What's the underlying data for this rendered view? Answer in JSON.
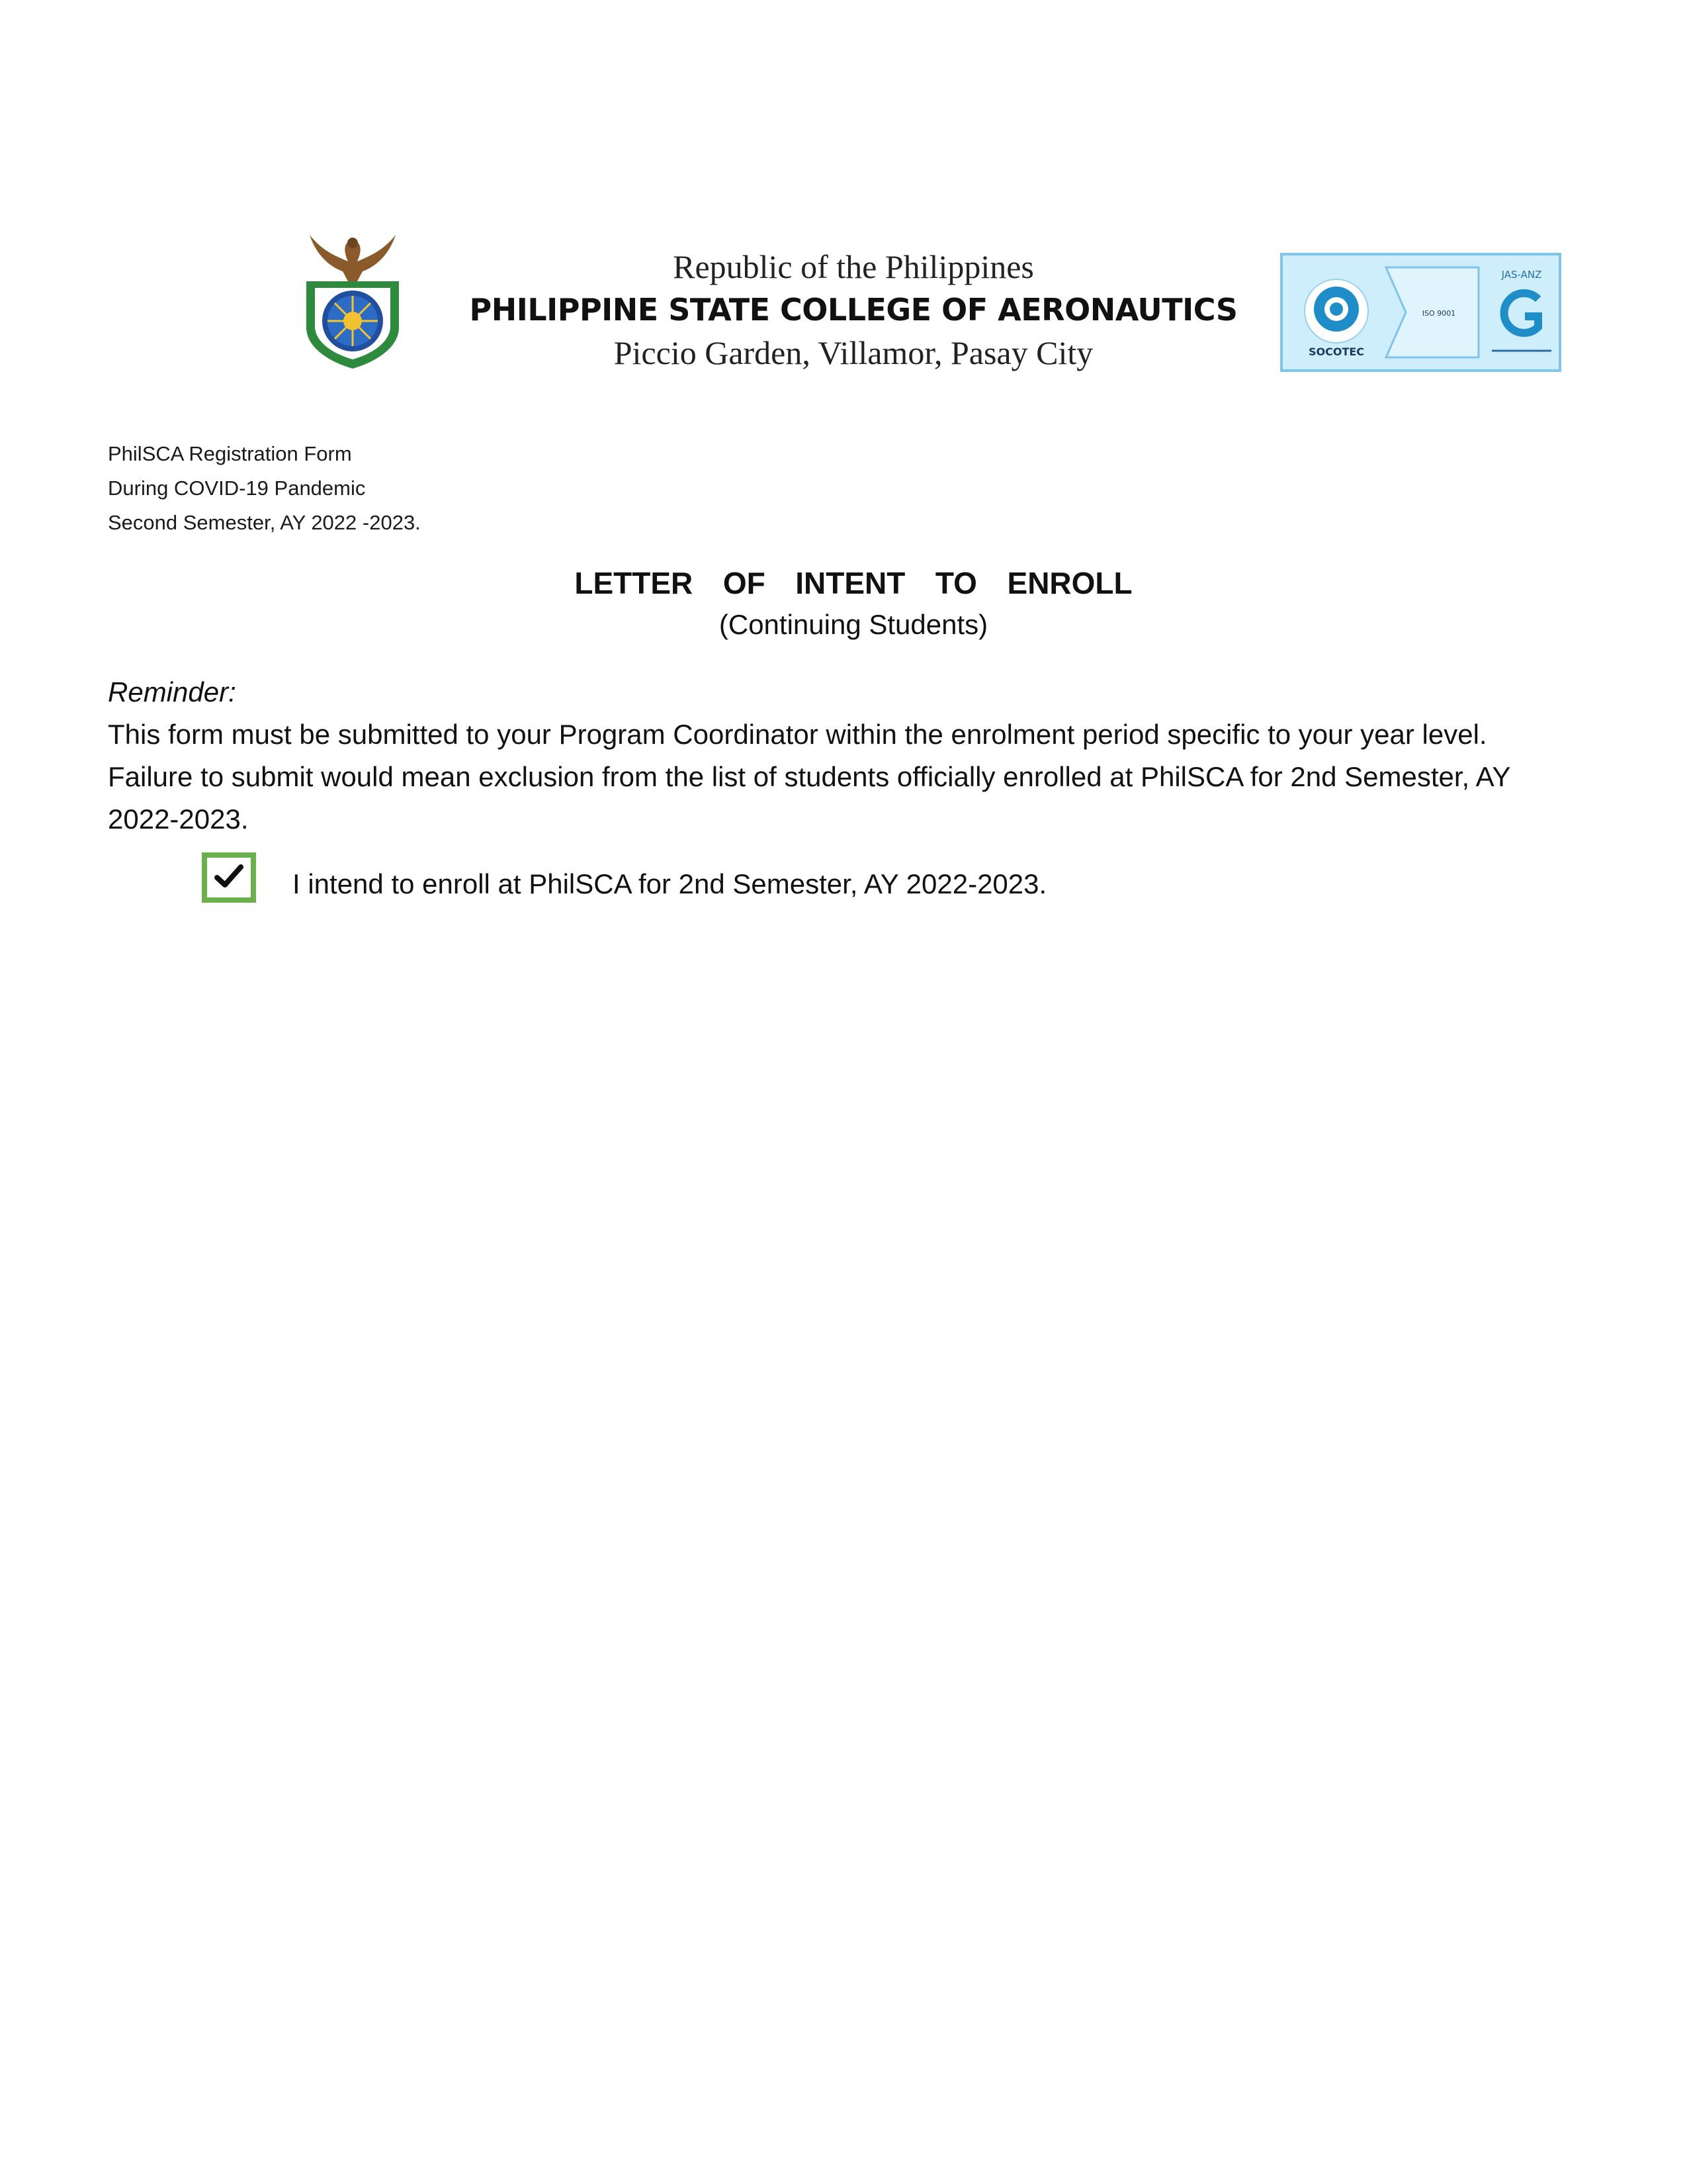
{
  "letterhead": {
    "line1": "Republic of the Philippines",
    "line2": "PHILIPPINE STATE COLLEGE OF AERONAUTICS",
    "line3": "Piccio Garden, Villamor, Pasay City"
  },
  "certification": {
    "left_label": "SOCOTEC",
    "middle_label": "ISO 9001",
    "right_label": "JAS-ANZ"
  },
  "form_meta": {
    "line1": "PhilSCA Registration Form",
    "line2": "During COVID-19 Pandemic",
    "line3": "Second Semester, AY 2022 -2023."
  },
  "title": {
    "main": "LETTER  OF  INTENT  TO  ENROLL",
    "sub": "(Continuing Students)"
  },
  "reminder": {
    "label": "Reminder:",
    "text": "This form must be submitted to your Program Coordinator within the enrolment period specific to your year level.  Failure to submit would mean exclusion from the list of students officially enrolled at PhilSCA for 2nd Semester, AY 2022-2023."
  },
  "intent": {
    "checked": true,
    "text": "I intend to enroll at PhilSCA for 2nd Semester, AY 2022-2023."
  },
  "colors": {
    "checkbox_border": "#6ab04c",
    "cert_background": "#cfeefb",
    "cert_blue": "#1f8ec8",
    "seal_green": "#2e8b3d",
    "eagle_brown": "#8a5a2b"
  }
}
